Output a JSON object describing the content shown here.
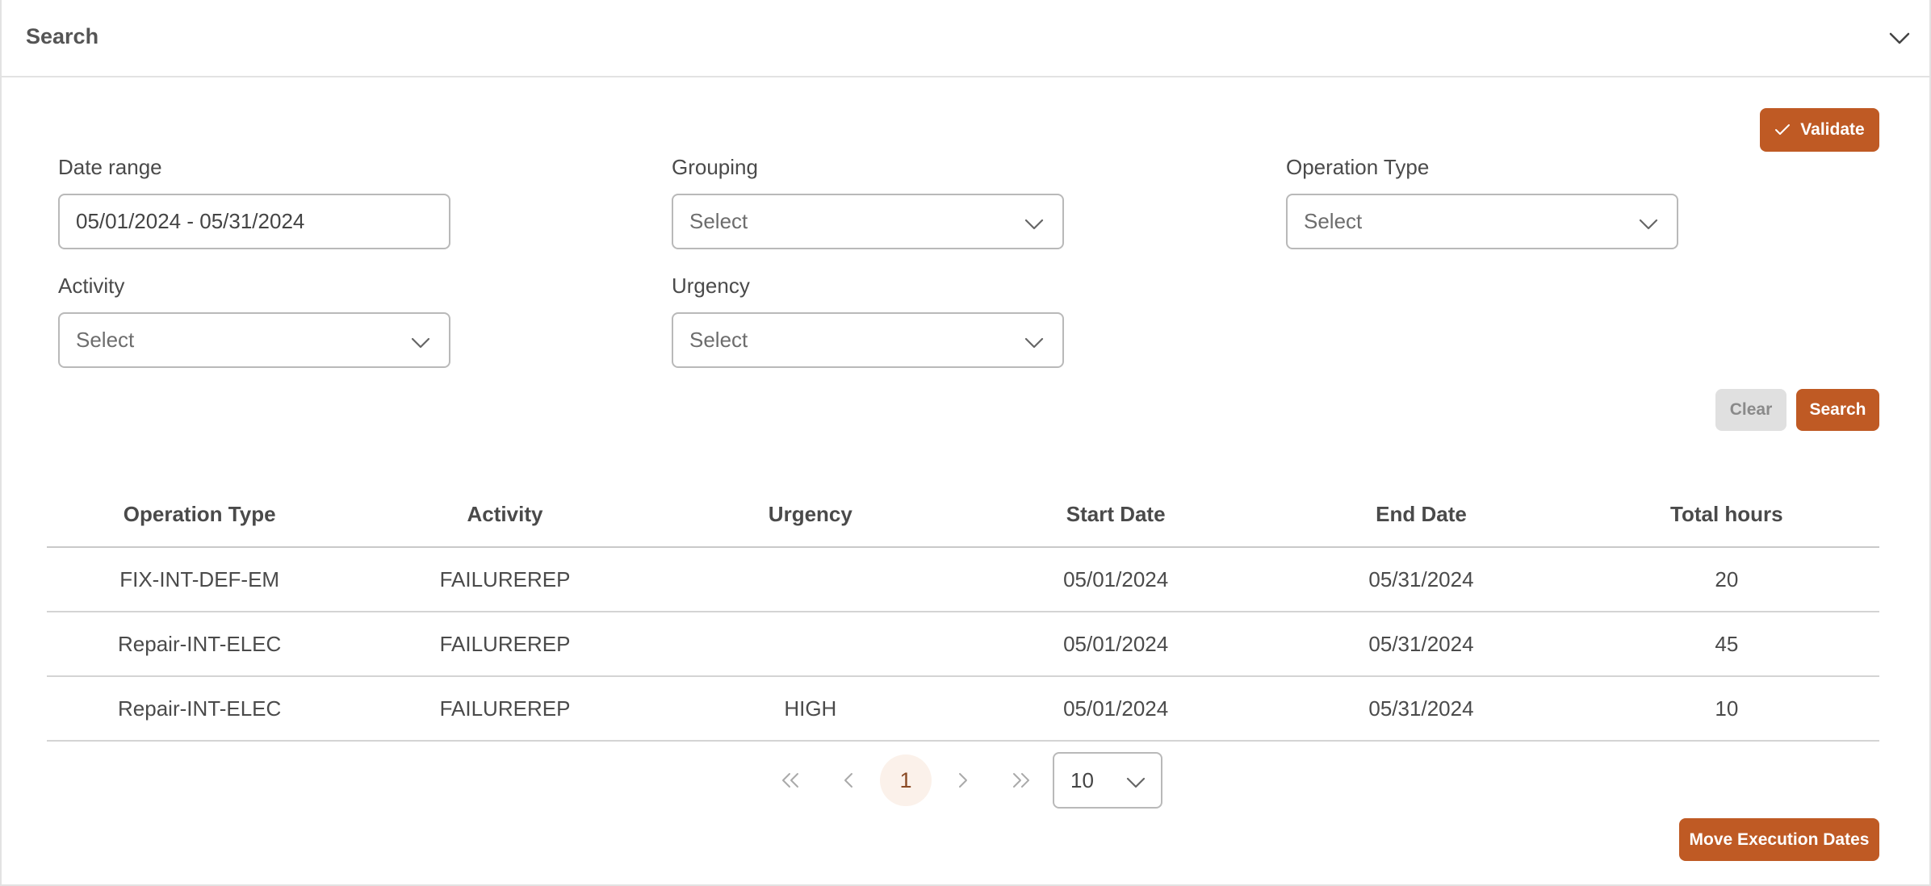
{
  "panel": {
    "title": "Search"
  },
  "actions": {
    "validate_label": "Validate",
    "clear_label": "Clear",
    "search_label": "Search",
    "move_label": "Move Execution Dates"
  },
  "filters": {
    "date_range": {
      "label": "Date range",
      "value": "05/01/2024 - 05/31/2024"
    },
    "grouping": {
      "label": "Grouping",
      "placeholder": "Select"
    },
    "operation_type": {
      "label": "Operation Type",
      "placeholder": "Select"
    },
    "activity": {
      "label": "Activity",
      "placeholder": "Select"
    },
    "urgency": {
      "label": "Urgency",
      "placeholder": "Select"
    }
  },
  "table": {
    "headers": [
      "Operation Type",
      "Activity",
      "Urgency",
      "Start Date",
      "End Date",
      "Total hours"
    ],
    "rows": [
      [
        "FIX-INT-DEF-EM",
        "FAILUREREP",
        "",
        "05/01/2024",
        "05/31/2024",
        "20"
      ],
      [
        "Repair-INT-ELEC",
        "FAILUREREP",
        "",
        "05/01/2024",
        "05/31/2024",
        "45"
      ],
      [
        "Repair-INT-ELEC",
        "FAILUREREP",
        "HIGH",
        "05/01/2024",
        "05/31/2024",
        "10"
      ]
    ]
  },
  "pagination": {
    "current_page": "1",
    "page_size": "10"
  },
  "colors": {
    "accent": "#bf5a24",
    "clear_bg": "#e0e0e0",
    "border": "#b9b9b9"
  },
  "icons": [
    "chevron-down-icon",
    "check-icon",
    "first-page-icon",
    "prev-page-icon",
    "next-page-icon",
    "last-page-icon"
  ]
}
